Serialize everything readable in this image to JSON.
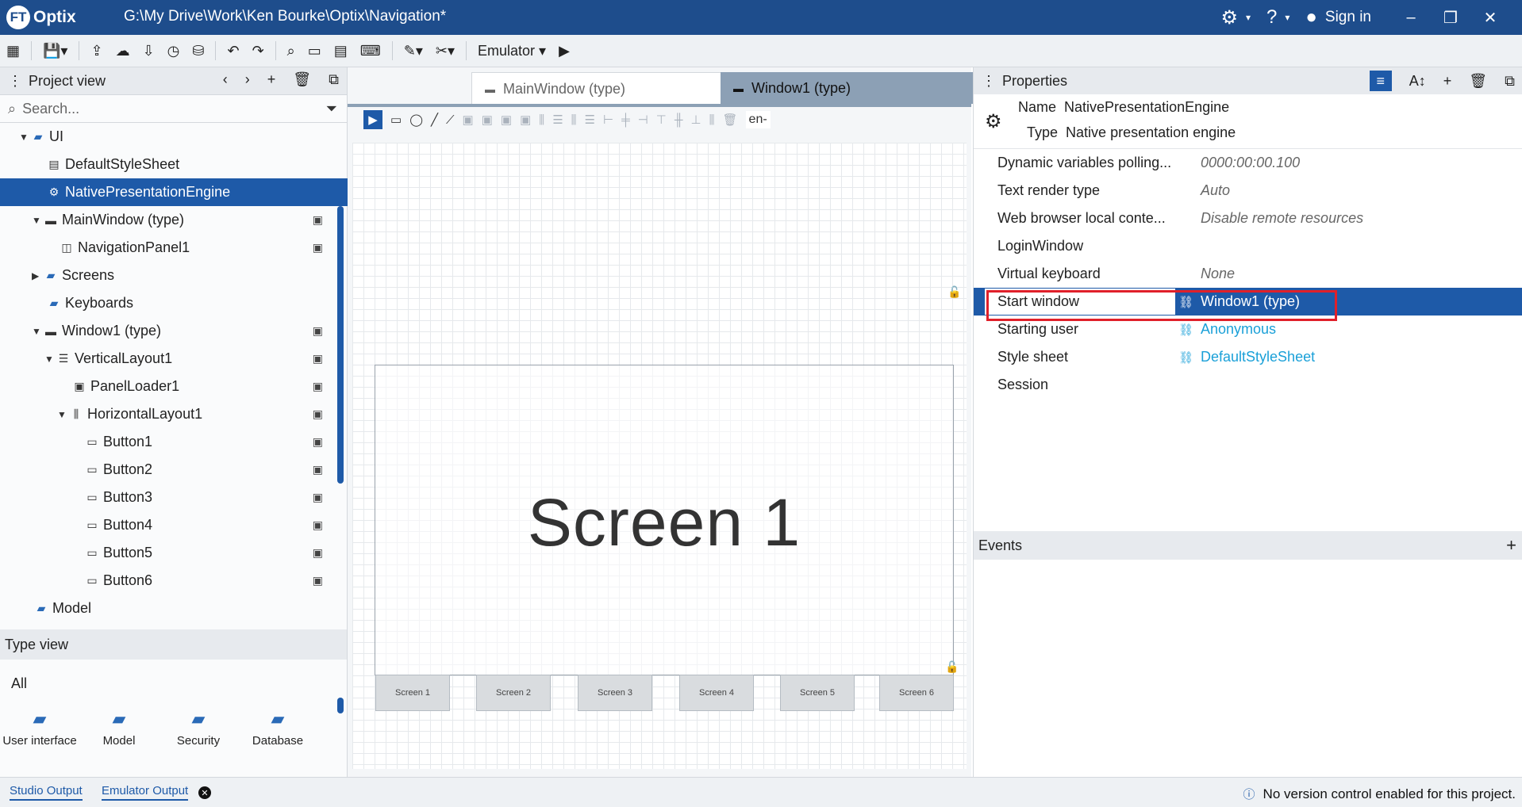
{
  "titlebar": {
    "logo_ft": "FT",
    "logo_name": "Optix",
    "path": "G:\\My Drive\\Work\\Ken Bourke\\Optix\\Navigation*",
    "signin": "Sign in",
    "settings_icon": "gear-icon",
    "help_icon": "help-icon"
  },
  "toolbar": {
    "emulator_label": "Emulator"
  },
  "project_view": {
    "title": "Project view",
    "search_placeholder": "Search...",
    "items": [
      {
        "label": "UI"
      },
      {
        "label": "DefaultStyleSheet"
      },
      {
        "label": "NativePresentationEngine"
      },
      {
        "label": "MainWindow (type)"
      },
      {
        "label": "NavigationPanel1"
      },
      {
        "label": "Screens"
      },
      {
        "label": "Keyboards"
      },
      {
        "label": "Window1 (type)"
      },
      {
        "label": "VerticalLayout1"
      },
      {
        "label": "PanelLoader1"
      },
      {
        "label": "HorizontalLayout1"
      },
      {
        "label": "Button1"
      },
      {
        "label": "Button2"
      },
      {
        "label": "Button3"
      },
      {
        "label": "Button4"
      },
      {
        "label": "Button5"
      },
      {
        "label": "Button6"
      },
      {
        "label": "Model"
      }
    ]
  },
  "type_view": {
    "title": "Type view",
    "filter": "All",
    "items": [
      {
        "label": "User interface"
      },
      {
        "label": "Model"
      },
      {
        "label": "Security"
      },
      {
        "label": "Database"
      }
    ]
  },
  "editor": {
    "tabs": [
      {
        "label": "MainWindow (type)"
      },
      {
        "label": "Window1 (type)"
      }
    ],
    "locale_short": "en-",
    "screen_text": "Screen 1",
    "nav_buttons": [
      "Screen 1",
      "Screen 2",
      "Screen 3",
      "Screen 4",
      "Screen 5",
      "Screen 6"
    ]
  },
  "properties": {
    "title": "Properties",
    "name_label": "Name",
    "name_value": "NativePresentationEngine",
    "type_label": "Type",
    "type_value": "Native presentation engine",
    "rows": [
      {
        "key": "Dynamic variables polling...",
        "value": "0000:00:00.100"
      },
      {
        "key": "Text render type",
        "value": "Auto"
      },
      {
        "key": "Web browser local conte...",
        "value": "Disable remote resources"
      },
      {
        "key": "LoginWindow",
        "value": ""
      },
      {
        "key": "Virtual keyboard",
        "value": "None"
      },
      {
        "key": "Start window",
        "value": "Window1 (type)"
      },
      {
        "key": "Starting user",
        "value": "Anonymous"
      },
      {
        "key": "Style sheet",
        "value": "DefaultStyleSheet"
      },
      {
        "key": "Session",
        "value": ""
      }
    ],
    "events_title": "Events"
  },
  "statusbar": {
    "tab1": "Studio Output",
    "tab2": "Emulator Output",
    "message": "No version control enabled for this project."
  }
}
